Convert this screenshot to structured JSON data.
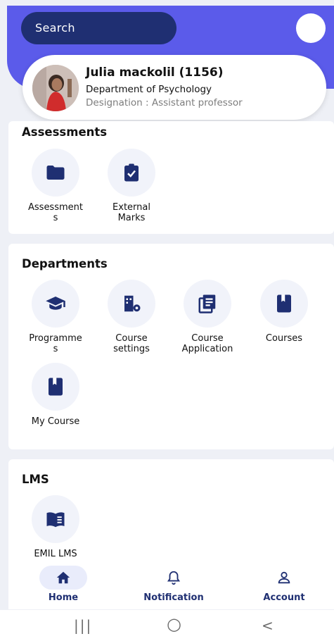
{
  "header": {
    "search_placeholder": "Search",
    "accent_color": "#5b5bea",
    "search_bg": "#1f2f72"
  },
  "profile": {
    "name": "Julia mackolil (1156)",
    "department": "Department of Psychology",
    "designation": "Designation :  Assistant professor"
  },
  "sections": {
    "assessments": {
      "title": "Assessments",
      "items": [
        {
          "label_l1": "Assessment",
          "label_l2": "s",
          "icon": "folder-icon"
        },
        {
          "label_l1": "External",
          "label_l2": "Marks",
          "icon": "clipboard-check-icon"
        }
      ]
    },
    "departments": {
      "title": "Departments",
      "items": [
        {
          "label_l1": "Programme",
          "label_l2": "s",
          "icon": "graduation-cap-icon"
        },
        {
          "label_l1": "Course",
          "label_l2": "settings",
          "icon": "building-gear-icon"
        },
        {
          "label_l1": "Course",
          "label_l2": "Application",
          "icon": "document-list-icon"
        },
        {
          "label_l1": "Courses",
          "label_l2": "",
          "icon": "book-icon"
        },
        {
          "label_l1": "My Course",
          "label_l2": "",
          "icon": "book-icon"
        }
      ]
    },
    "lms": {
      "title": "LMS",
      "items": [
        {
          "label_l1": "EMIL LMS",
          "label_l2": "",
          "icon": "open-book-icon"
        }
      ]
    }
  },
  "nav": {
    "items": [
      {
        "label": "Home",
        "icon": "home-icon",
        "active": true
      },
      {
        "label": "Notification",
        "icon": "bell-icon",
        "active": false
      },
      {
        "label": "Account",
        "icon": "user-icon",
        "active": false
      }
    ]
  },
  "system_bar": {
    "recents": "|||",
    "home": "○",
    "back": "<"
  }
}
